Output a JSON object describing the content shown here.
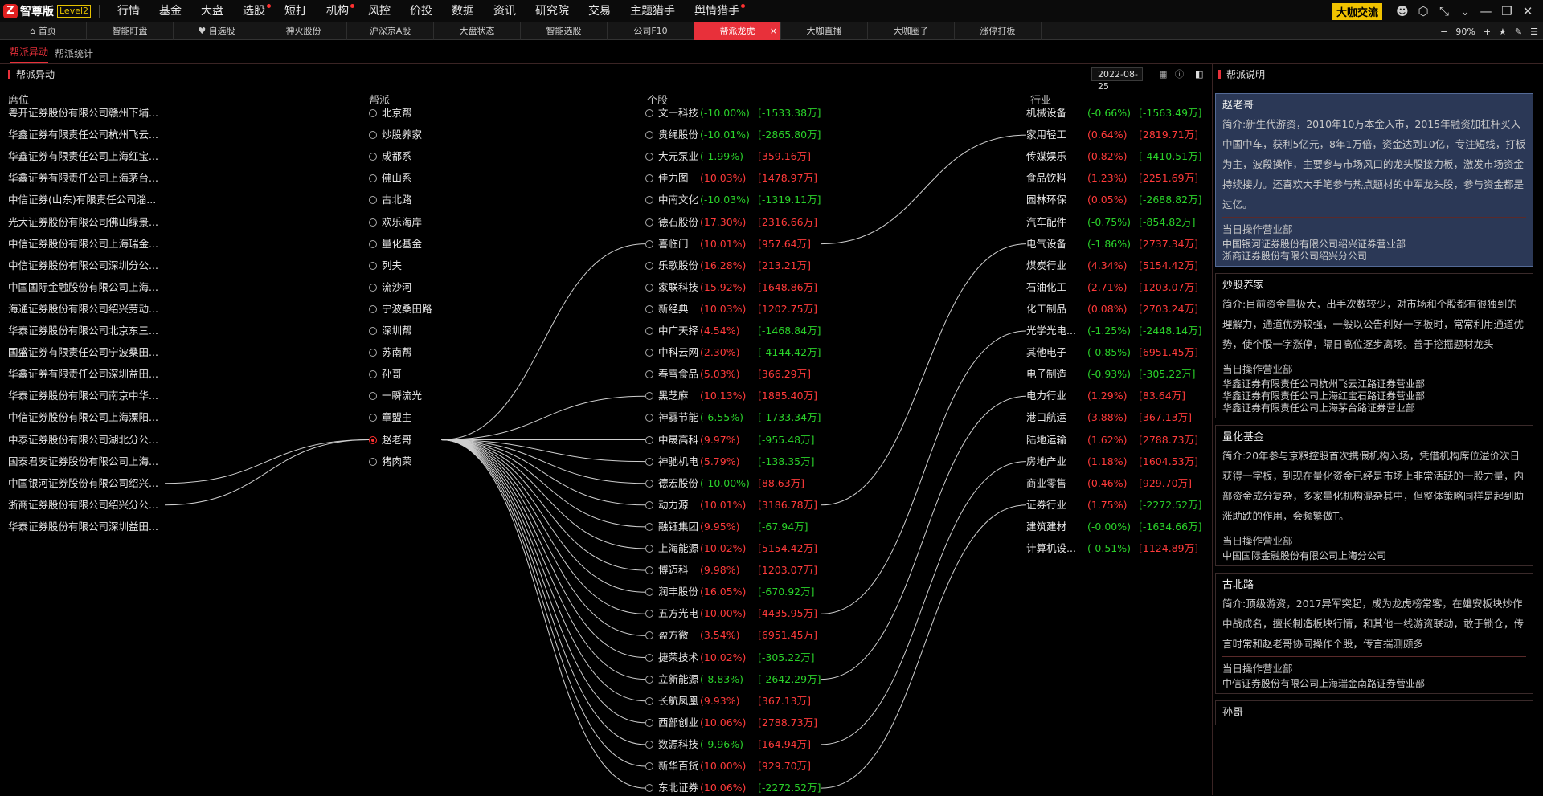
{
  "app": {
    "logo_mark": "Z",
    "name": "智尊版",
    "badge": "Level2",
    "menu": [
      {
        "label": "行情",
        "dot": false
      },
      {
        "label": "基金",
        "dot": false
      },
      {
        "label": "大盘",
        "dot": false
      },
      {
        "label": "选股",
        "dot": true
      },
      {
        "label": "短打",
        "dot": false
      },
      {
        "label": "机构",
        "dot": true
      },
      {
        "label": "风控",
        "dot": false
      },
      {
        "label": "价投",
        "dot": false
      },
      {
        "label": "数据",
        "dot": false
      },
      {
        "label": "资讯",
        "dot": false
      },
      {
        "label": "研究院",
        "dot": false
      },
      {
        "label": "交易",
        "dot": false
      },
      {
        "label": "主题猎手",
        "dot": false
      },
      {
        "label": "舆情猎手",
        "dot": true
      }
    ],
    "coffee_button": "大咖交流",
    "window_icons": [
      "user-icon",
      "settings-icon",
      "collapse-icon",
      "dropdown-icon",
      "minimize-icon",
      "restore-icon",
      "close-icon"
    ]
  },
  "tabs": [
    {
      "label": "⌂ 首页",
      "active": false
    },
    {
      "label": "智能盯盘",
      "active": false
    },
    {
      "label": "♥ 自选股",
      "active": false
    },
    {
      "label": "神火股份",
      "active": false
    },
    {
      "label": "沪深京A股",
      "active": false
    },
    {
      "label": "大盘状态",
      "active": false
    },
    {
      "label": "智能选股",
      "active": false
    },
    {
      "label": "公司F10",
      "active": false
    },
    {
      "label": "帮派龙虎",
      "active": true
    },
    {
      "label": "大咖直播",
      "active": false
    },
    {
      "label": "大咖圈子",
      "active": false
    },
    {
      "label": "涨停打板",
      "active": false
    }
  ],
  "tab_close": "×",
  "zoom": {
    "minus": "−",
    "level": "90%",
    "plus": "+"
  },
  "subtabs": [
    {
      "label": "帮派异动",
      "active": true
    },
    {
      "label": "帮派统计",
      "active": false
    }
  ],
  "left_panel": {
    "title": "帮派异动",
    "date": "2022-08-25",
    "headers": {
      "seat": "席位",
      "faction": "帮派",
      "stock": "个股",
      "industry": "行业"
    }
  },
  "seats": [
    "粤开证券股份有限公司赣州下埔...",
    "华鑫证券有限责任公司杭州飞云...",
    "华鑫证券有限责任公司上海红宝...",
    "华鑫证券有限责任公司上海茅台...",
    "中信证券(山东)有限责任公司淄...",
    "光大证券股份有限公司佛山绿景...",
    "中信证券股份有限公司上海瑞金...",
    "中信证券股份有限公司深圳分公...",
    "中国国际金融股份有限公司上海...",
    "海通证券股份有限公司绍兴劳动...",
    "华泰证券股份有限公司北京东三...",
    "国盛证券有限责任公司宁波桑田...",
    "华鑫证券有限责任公司深圳益田...",
    "华泰证券股份有限公司南京中华...",
    "中信证券股份有限公司上海溧阳...",
    "中泰证券股份有限公司湖北分公...",
    "国泰君安证券股份有限公司上海...",
    "中国银河证券股份有限公司绍兴...",
    "浙商证券股份有限公司绍兴分公...",
    "华泰证券股份有限公司深圳益田..."
  ],
  "factions": [
    {
      "name": "北京帮",
      "selected": false
    },
    {
      "name": "炒股养家",
      "selected": false
    },
    {
      "name": "成都系",
      "selected": false
    },
    {
      "name": "佛山系",
      "selected": false
    },
    {
      "name": "古北路",
      "selected": false
    },
    {
      "name": "欢乐海岸",
      "selected": false
    },
    {
      "name": "量化基金",
      "selected": false
    },
    {
      "name": "列夫",
      "selected": false
    },
    {
      "name": "流沙河",
      "selected": false
    },
    {
      "name": "宁波桑田路",
      "selected": false
    },
    {
      "name": "深圳帮",
      "selected": false
    },
    {
      "name": "苏南帮",
      "selected": false
    },
    {
      "name": "孙哥",
      "selected": false
    },
    {
      "name": "一瞬流光",
      "selected": false
    },
    {
      "name": "章盟主",
      "selected": false
    },
    {
      "name": "赵老哥",
      "selected": true
    },
    {
      "name": "猪肉荣",
      "selected": false
    }
  ],
  "stocks": [
    {
      "name": "文一科技",
      "pct": "(-10.00%)",
      "amt": "[-1533.38万]",
      "pct_up": false,
      "amt_up": false
    },
    {
      "name": "贵绳股份",
      "pct": "(-10.01%)",
      "amt": "[-2865.80万]",
      "pct_up": false,
      "amt_up": false
    },
    {
      "name": "大元泵业",
      "pct": "(-1.99%)",
      "amt": "[359.16万]",
      "pct_up": false,
      "amt_up": true
    },
    {
      "name": "佳力图",
      "pct": "(10.03%)",
      "amt": "[1478.97万]",
      "pct_up": true,
      "amt_up": true
    },
    {
      "name": "中南文化",
      "pct": "(-10.03%)",
      "amt": "[-1319.11万]",
      "pct_up": false,
      "amt_up": false
    },
    {
      "name": "德石股份",
      "pct": "(17.30%)",
      "amt": "[2316.66万]",
      "pct_up": true,
      "amt_up": true
    },
    {
      "name": "喜临门",
      "pct": "(10.01%)",
      "amt": "[957.64万]",
      "pct_up": true,
      "amt_up": true
    },
    {
      "name": "乐歌股份",
      "pct": "(16.28%)",
      "amt": "[213.21万]",
      "pct_up": true,
      "amt_up": true
    },
    {
      "name": "家联科技",
      "pct": "(15.92%)",
      "amt": "[1648.86万]",
      "pct_up": true,
      "amt_up": true
    },
    {
      "name": "新经典",
      "pct": "(10.03%)",
      "amt": "[1202.75万]",
      "pct_up": true,
      "amt_up": true
    },
    {
      "name": "中广天择",
      "pct": "(4.54%)",
      "amt": "[-1468.84万]",
      "pct_up": true,
      "amt_up": false
    },
    {
      "name": "中科云网",
      "pct": "(2.30%)",
      "amt": "[-4144.42万]",
      "pct_up": true,
      "amt_up": false
    },
    {
      "name": "春雪食品",
      "pct": "(5.03%)",
      "amt": "[366.29万]",
      "pct_up": true,
      "amt_up": true
    },
    {
      "name": "黑芝麻",
      "pct": "(10.13%)",
      "amt": "[1885.40万]",
      "pct_up": true,
      "amt_up": true
    },
    {
      "name": "神雾节能",
      "pct": "(-6.55%)",
      "amt": "[-1733.34万]",
      "pct_up": false,
      "amt_up": false
    },
    {
      "name": "中晟高科",
      "pct": "(9.97%)",
      "amt": "[-955.48万]",
      "pct_up": true,
      "amt_up": false
    },
    {
      "name": "神驰机电",
      "pct": "(5.79%)",
      "amt": "[-138.35万]",
      "pct_up": true,
      "amt_up": false
    },
    {
      "name": "德宏股份",
      "pct": "(-10.00%)",
      "amt": "[88.63万]",
      "pct_up": false,
      "amt_up": true
    },
    {
      "name": "动力源",
      "pct": "(10.01%)",
      "amt": "[3186.78万]",
      "pct_up": true,
      "amt_up": true
    },
    {
      "name": "融钰集团",
      "pct": "(9.95%)",
      "amt": "[-67.94万]",
      "pct_up": true,
      "amt_up": false
    },
    {
      "name": "上海能源",
      "pct": "(10.02%)",
      "amt": "[5154.42万]",
      "pct_up": true,
      "amt_up": true
    },
    {
      "name": "博迈科",
      "pct": "(9.98%)",
      "amt": "[1203.07万]",
      "pct_up": true,
      "amt_up": true
    },
    {
      "name": "润丰股份",
      "pct": "(16.05%)",
      "amt": "[-670.92万]",
      "pct_up": true,
      "amt_up": false
    },
    {
      "name": "五方光电",
      "pct": "(10.00%)",
      "amt": "[4435.95万]",
      "pct_up": true,
      "amt_up": true
    },
    {
      "name": "盈方微",
      "pct": "(3.54%)",
      "amt": "[6951.45万]",
      "pct_up": true,
      "amt_up": true
    },
    {
      "name": "捷荣技术",
      "pct": "(10.02%)",
      "amt": "[-305.22万]",
      "pct_up": true,
      "amt_up": false
    },
    {
      "name": "立新能源",
      "pct": "(-8.83%)",
      "amt": "[-2642.29万]",
      "pct_up": false,
      "amt_up": false
    },
    {
      "name": "长航凤凰",
      "pct": "(9.93%)",
      "amt": "[367.13万]",
      "pct_up": true,
      "amt_up": true
    },
    {
      "name": "西部创业",
      "pct": "(10.06%)",
      "amt": "[2788.73万]",
      "pct_up": true,
      "amt_up": true
    },
    {
      "name": "数源科技",
      "pct": "(-9.96%)",
      "amt": "[164.94万]",
      "pct_up": false,
      "amt_up": true
    },
    {
      "name": "新华百货",
      "pct": "(10.00%)",
      "amt": "[929.70万]",
      "pct_up": true,
      "amt_up": true
    },
    {
      "name": "东北证券",
      "pct": "(10.06%)",
      "amt": "[-2272.52万]",
      "pct_up": true,
      "amt_up": false
    }
  ],
  "industries": [
    {
      "name": "机械设备",
      "pct": "(-0.66%)",
      "amt": "[-1563.49万]",
      "pct_up": false,
      "amt_up": false
    },
    {
      "name": "家用轻工",
      "pct": "(0.64%)",
      "amt": "[2819.71万]",
      "pct_up": true,
      "amt_up": true
    },
    {
      "name": "传媒娱乐",
      "pct": "(0.82%)",
      "amt": "[-4410.51万]",
      "pct_up": true,
      "amt_up": false
    },
    {
      "name": "食品饮料",
      "pct": "(1.23%)",
      "amt": "[2251.69万]",
      "pct_up": true,
      "amt_up": true
    },
    {
      "name": "园林环保",
      "pct": "(0.05%)",
      "amt": "[-2688.82万]",
      "pct_up": true,
      "amt_up": false
    },
    {
      "name": "汽车配件",
      "pct": "(-0.75%)",
      "amt": "[-854.82万]",
      "pct_up": false,
      "amt_up": false
    },
    {
      "name": "电气设备",
      "pct": "(-1.86%)",
      "amt": "[2737.34万]",
      "pct_up": false,
      "amt_up": true
    },
    {
      "name": "煤炭行业",
      "pct": "(4.34%)",
      "amt": "[5154.42万]",
      "pct_up": true,
      "amt_up": true
    },
    {
      "name": "石油化工",
      "pct": "(2.71%)",
      "amt": "[1203.07万]",
      "pct_up": true,
      "amt_up": true
    },
    {
      "name": "化工制品",
      "pct": "(0.08%)",
      "amt": "[2703.24万]",
      "pct_up": true,
      "amt_up": true
    },
    {
      "name": "光学光电...",
      "pct": "(-1.25%)",
      "amt": "[-2448.14万]",
      "pct_up": false,
      "amt_up": false
    },
    {
      "name": "其他电子",
      "pct": "(-0.85%)",
      "amt": "[6951.45万]",
      "pct_up": false,
      "amt_up": true
    },
    {
      "name": "电子制造",
      "pct": "(-0.93%)",
      "amt": "[-305.22万]",
      "pct_up": false,
      "amt_up": false
    },
    {
      "name": "电力行业",
      "pct": "(1.29%)",
      "amt": "[83.64万]",
      "pct_up": true,
      "amt_up": true
    },
    {
      "name": "港口航运",
      "pct": "(3.88%)",
      "amt": "[367.13万]",
      "pct_up": true,
      "amt_up": true
    },
    {
      "name": "陆地运输",
      "pct": "(1.62%)",
      "amt": "[2788.73万]",
      "pct_up": true,
      "amt_up": true
    },
    {
      "name": "房地产业",
      "pct": "(1.18%)",
      "amt": "[1604.53万]",
      "pct_up": true,
      "amt_up": true
    },
    {
      "name": "商业零售",
      "pct": "(0.46%)",
      "amt": "[929.70万]",
      "pct_up": true,
      "amt_up": true
    },
    {
      "name": "证券行业",
      "pct": "(1.75%)",
      "amt": "[-2272.52万]",
      "pct_up": true,
      "amt_up": false
    },
    {
      "name": "建筑建材",
      "pct": "(-0.00%)",
      "amt": "[-1634.66万]",
      "pct_up": false,
      "amt_up": false
    },
    {
      "name": "计算机设...",
      "pct": "(-0.51%)",
      "amt": "[1124.89万]",
      "pct_up": false,
      "amt_up": true
    }
  ],
  "links": {
    "seat_to_faction": [
      17,
      18
    ],
    "selected_faction": 15,
    "faction_to_stock": [
      6,
      13,
      15,
      16,
      17,
      18,
      19,
      20,
      21,
      22,
      23,
      24,
      25,
      26,
      27,
      28,
      29,
      30,
      31
    ],
    "stock_to_industry": [
      [
        6,
        1
      ],
      [
        18,
        6
      ],
      [
        23,
        10
      ],
      [
        26,
        13
      ],
      [
        29,
        16
      ],
      [
        31,
        18
      ]
    ]
  },
  "right_panel": {
    "title": "帮派说明",
    "sub_heading": "当日操作营业部",
    "cards": [
      {
        "name": "赵老哥",
        "highlight": true,
        "desc": "简介:新生代游资，2010年10万本金入市，2015年融资加杠杆买入中国中车，获利5亿元，8年1万倍，资金达到10亿，专注短线，打板为主，波段操作，主要参与市场风口的龙头股接力板，激发市场资金持续接力。还喜欢大手笔参与热点题材的中军龙头股，参与资金都是过亿。",
        "branches": [
          "中国银河证券股份有限公司绍兴证券营业部",
          "浙商证券股份有限公司绍兴分公司"
        ]
      },
      {
        "name": "炒股养家",
        "highlight": false,
        "desc": "简介:目前资金量极大，出手次数较少，对市场和个股都有很独到的理解力，通道优势较强，一般以公告利好一字板时，常常利用通道优势，使个股一字涨停，隔日高位逐步离场。善于挖掘题材龙头",
        "branches": [
          "华鑫证券有限责任公司杭州飞云江路证券营业部",
          "华鑫证券有限责任公司上海红宝石路证券营业部",
          "华鑫证券有限责任公司上海茅台路证券营业部"
        ]
      },
      {
        "name": "量化基金",
        "highlight": false,
        "desc": "简介:20年参与京粮控股首次携假机构入场，凭借机构席位溢价次日获得一字板，到现在量化资金已经是市场上非常活跃的一股力量，内部资金成分复杂，多家量化机构混杂其中，但整体策略同样是起到助涨助跌的作用，会频繁做T。",
        "branches": [
          "中国国际金融股份有限公司上海分公司"
        ]
      },
      {
        "name": "古北路",
        "highlight": false,
        "desc": "简介:顶级游资，2017异军突起，成为龙虎榜常客，在雄安板块炒作中战成名，擅长制造板块行情，和其他一线游资联动，敢于锁仓，传言时常和赵老哥协同操作个股，传言揣测颇多",
        "branches": [
          "中信证券股份有限公司上海瑞金南路证券营业部"
        ]
      },
      {
        "name": "孙哥",
        "highlight": false,
        "desc": "",
        "branches": []
      }
    ]
  }
}
